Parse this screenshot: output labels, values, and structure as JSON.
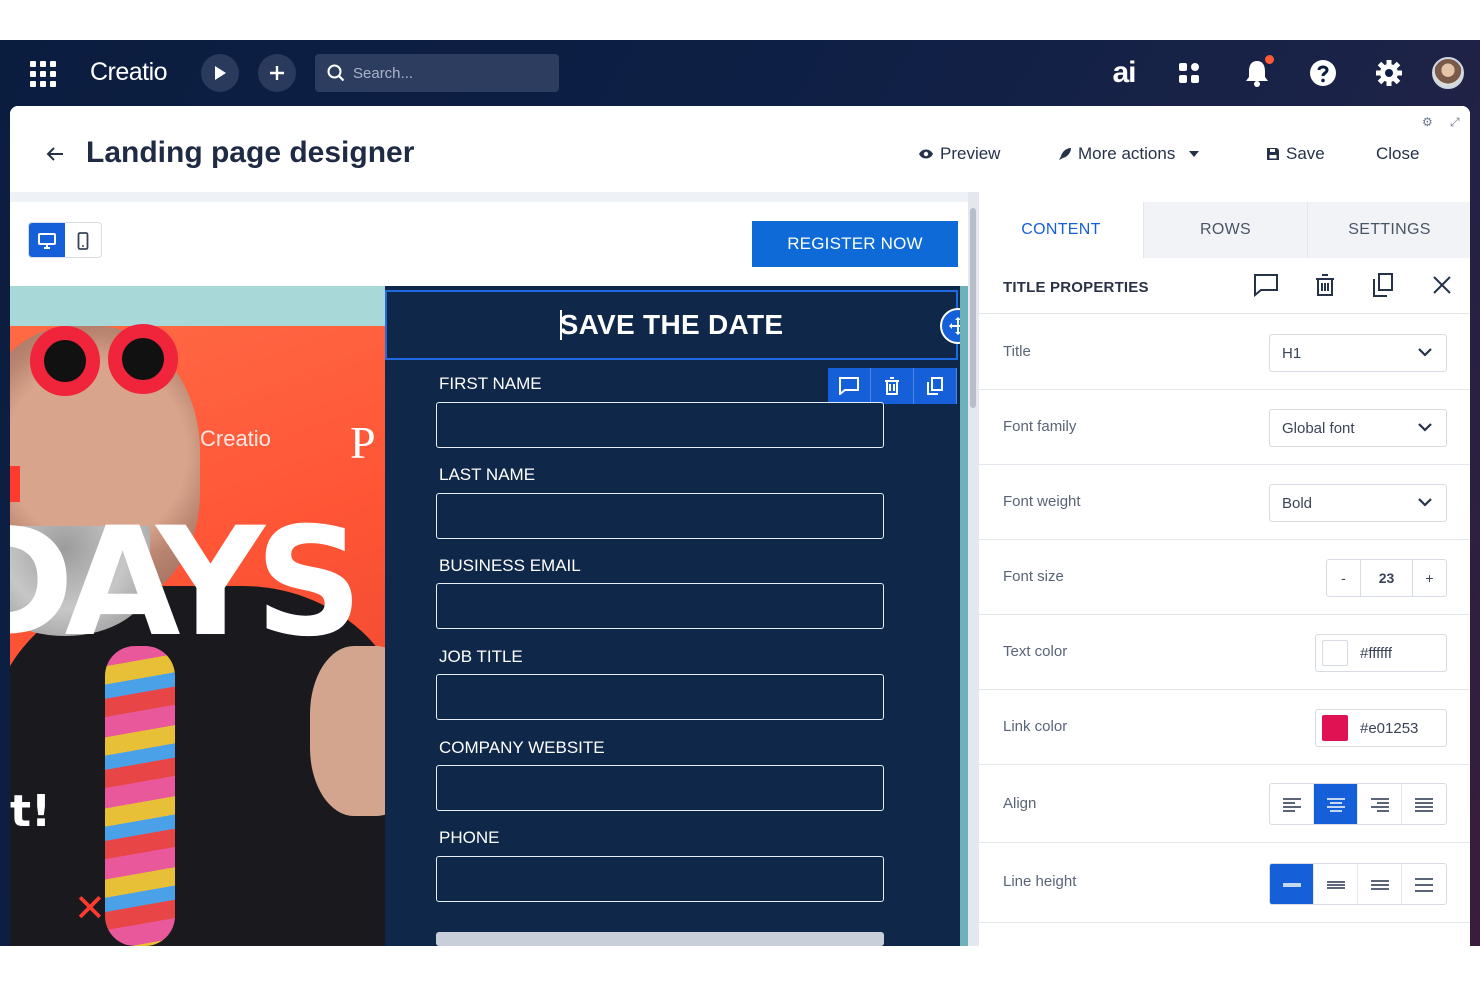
{
  "topbar": {
    "logo": "Creatio",
    "search_placeholder": "Search...",
    "ai_label": "ai"
  },
  "header": {
    "title": "Landing page designer",
    "preview": "Preview",
    "more_actions": "More actions",
    "save": "Save",
    "close": "Close"
  },
  "canvas": {
    "register_button": "REGISTER NOW",
    "form_title": "SAVE THE DATE",
    "hero_text": "DAYS",
    "hero_text_2": "t!",
    "hero_brand": "Creatio",
    "hero_letter": "P",
    "fields": [
      {
        "label": "FIRST NAME"
      },
      {
        "label": "LAST NAME"
      },
      {
        "label": "BUSINESS EMAIL"
      },
      {
        "label": "JOB TITLE"
      },
      {
        "label": "COMPANY WEBSITE"
      },
      {
        "label": "PHONE"
      }
    ]
  },
  "sidebar": {
    "tabs": [
      {
        "label": "CONTENT",
        "active": true
      },
      {
        "label": "ROWS",
        "active": false
      },
      {
        "label": "SETTINGS",
        "active": false
      }
    ],
    "properties_title": "TITLE PROPERTIES",
    "properties": {
      "title": {
        "label": "Title",
        "value": "H1"
      },
      "font_family": {
        "label": "Font family",
        "value": "Global font"
      },
      "font_weight": {
        "label": "Font weight",
        "value": "Bold"
      },
      "font_size": {
        "label": "Font size",
        "value": "23",
        "minus": "-",
        "plus": "+"
      },
      "text_color": {
        "label": "Text color",
        "value": "#ffffff"
      },
      "link_color": {
        "label": "Link color",
        "value": "#e01253"
      },
      "align": {
        "label": "Align",
        "selected": "center"
      },
      "line_height": {
        "label": "Line height",
        "selected": "single"
      }
    }
  },
  "colors": {
    "accent": "#1560d8",
    "form_background": "#0f2748",
    "text_color_swatch": "#ffffff",
    "link_color_swatch": "#e01253"
  }
}
